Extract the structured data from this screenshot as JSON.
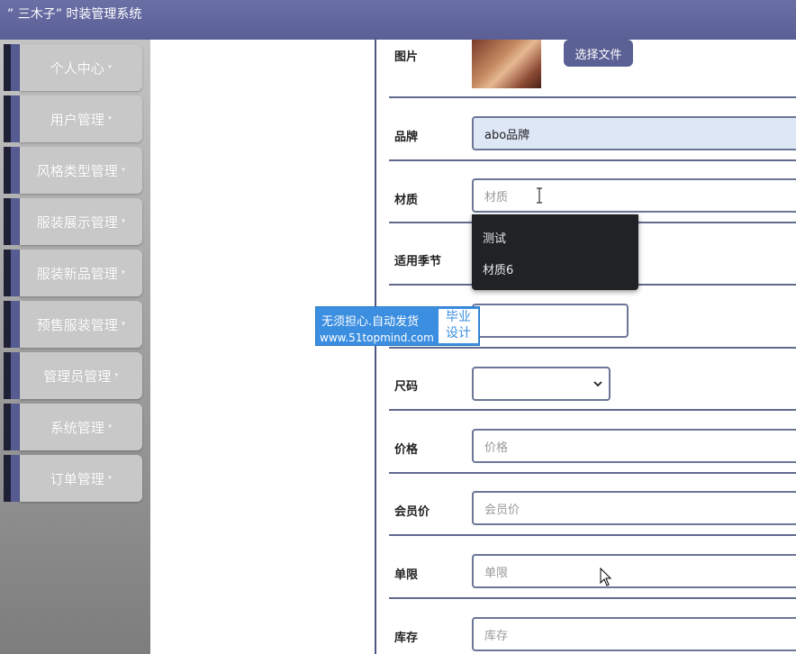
{
  "app": {
    "title": "” 三木子” 时装管理系统"
  },
  "sidebar": {
    "items": [
      {
        "label": "个人中心"
      },
      {
        "label": "用户管理"
      },
      {
        "label": "风格类型管理"
      },
      {
        "label": "服装展示管理"
      },
      {
        "label": "服装新品管理"
      },
      {
        "label": "预售服装管理"
      },
      {
        "label": "管理员管理"
      },
      {
        "label": "系统管理"
      },
      {
        "label": "订单管理"
      }
    ],
    "caret": "▾"
  },
  "form": {
    "image": {
      "label": "图片",
      "button": "选择文件"
    },
    "brand": {
      "label": "品牌",
      "value": "abo品牌"
    },
    "material": {
      "label": "材质",
      "placeholder": "材质",
      "suggestions": [
        "测试",
        "材质6"
      ]
    },
    "season": {
      "label": "适用季节"
    },
    "size": {
      "label": "尺码",
      "value": ""
    },
    "price": {
      "label": "价格",
      "placeholder": "价格"
    },
    "member_price": {
      "label": "会员价",
      "placeholder": "会员价"
    },
    "limit": {
      "label": "单限",
      "placeholder": "单限"
    },
    "stock": {
      "label": "库存",
      "placeholder": "库存"
    }
  },
  "watermark": {
    "line1": "无须担心.自动发货",
    "line2": "www.51topmind.com",
    "box_top": "毕业",
    "box_bottom": "设计"
  }
}
